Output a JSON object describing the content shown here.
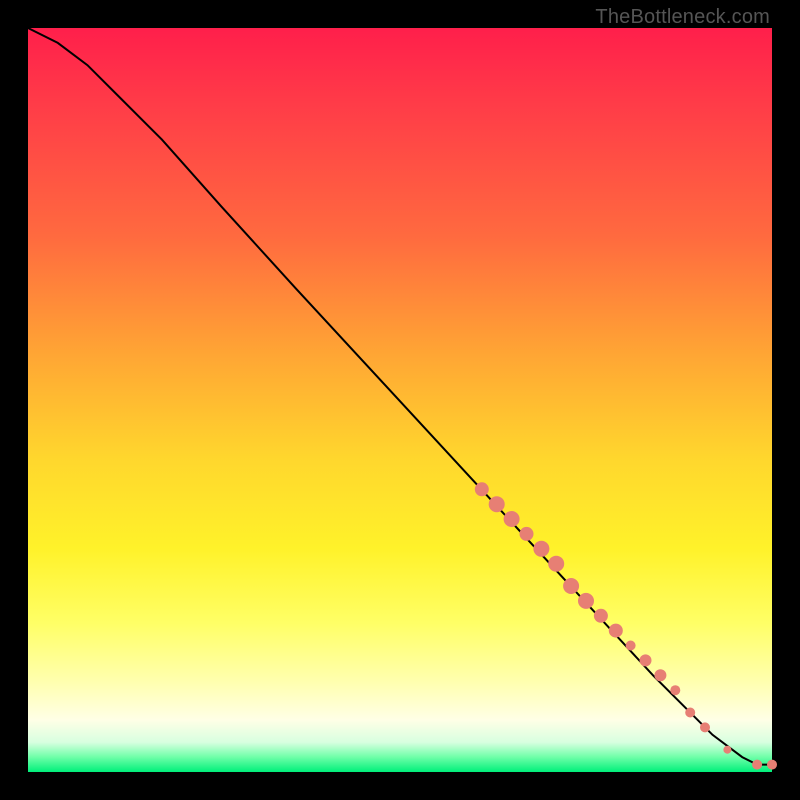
{
  "watermark": "TheBottleneck.com",
  "chart_data": {
    "type": "line",
    "title": "",
    "xlabel": "",
    "ylabel": "",
    "xlim": [
      0,
      100
    ],
    "ylim": [
      0,
      100
    ],
    "series": [
      {
        "name": "curve",
        "x": [
          0,
          4,
          8,
          12,
          18,
          26,
          36,
          48,
          60,
          72,
          84,
          92,
          96,
          98,
          100
        ],
        "y": [
          100,
          98,
          95,
          91,
          85,
          76,
          65,
          52,
          39,
          26,
          13,
          5,
          2,
          1,
          1
        ]
      }
    ],
    "markers": {
      "name": "highlighted-points",
      "color": "#e77f74",
      "points": [
        {
          "x": 61,
          "y": 38,
          "r": 7
        },
        {
          "x": 63,
          "y": 36,
          "r": 8
        },
        {
          "x": 65,
          "y": 34,
          "r": 8
        },
        {
          "x": 67,
          "y": 32,
          "r": 7
        },
        {
          "x": 69,
          "y": 30,
          "r": 8
        },
        {
          "x": 71,
          "y": 28,
          "r": 8
        },
        {
          "x": 73,
          "y": 25,
          "r": 8
        },
        {
          "x": 75,
          "y": 23,
          "r": 8
        },
        {
          "x": 77,
          "y": 21,
          "r": 7
        },
        {
          "x": 79,
          "y": 19,
          "r": 7
        },
        {
          "x": 81,
          "y": 17,
          "r": 5
        },
        {
          "x": 83,
          "y": 15,
          "r": 6
        },
        {
          "x": 85,
          "y": 13,
          "r": 6
        },
        {
          "x": 87,
          "y": 11,
          "r": 5
        },
        {
          "x": 89,
          "y": 8,
          "r": 5
        },
        {
          "x": 91,
          "y": 6,
          "r": 5
        },
        {
          "x": 94,
          "y": 3,
          "r": 4
        },
        {
          "x": 98,
          "y": 1,
          "r": 5
        },
        {
          "x": 100,
          "y": 1,
          "r": 5
        }
      ]
    }
  }
}
